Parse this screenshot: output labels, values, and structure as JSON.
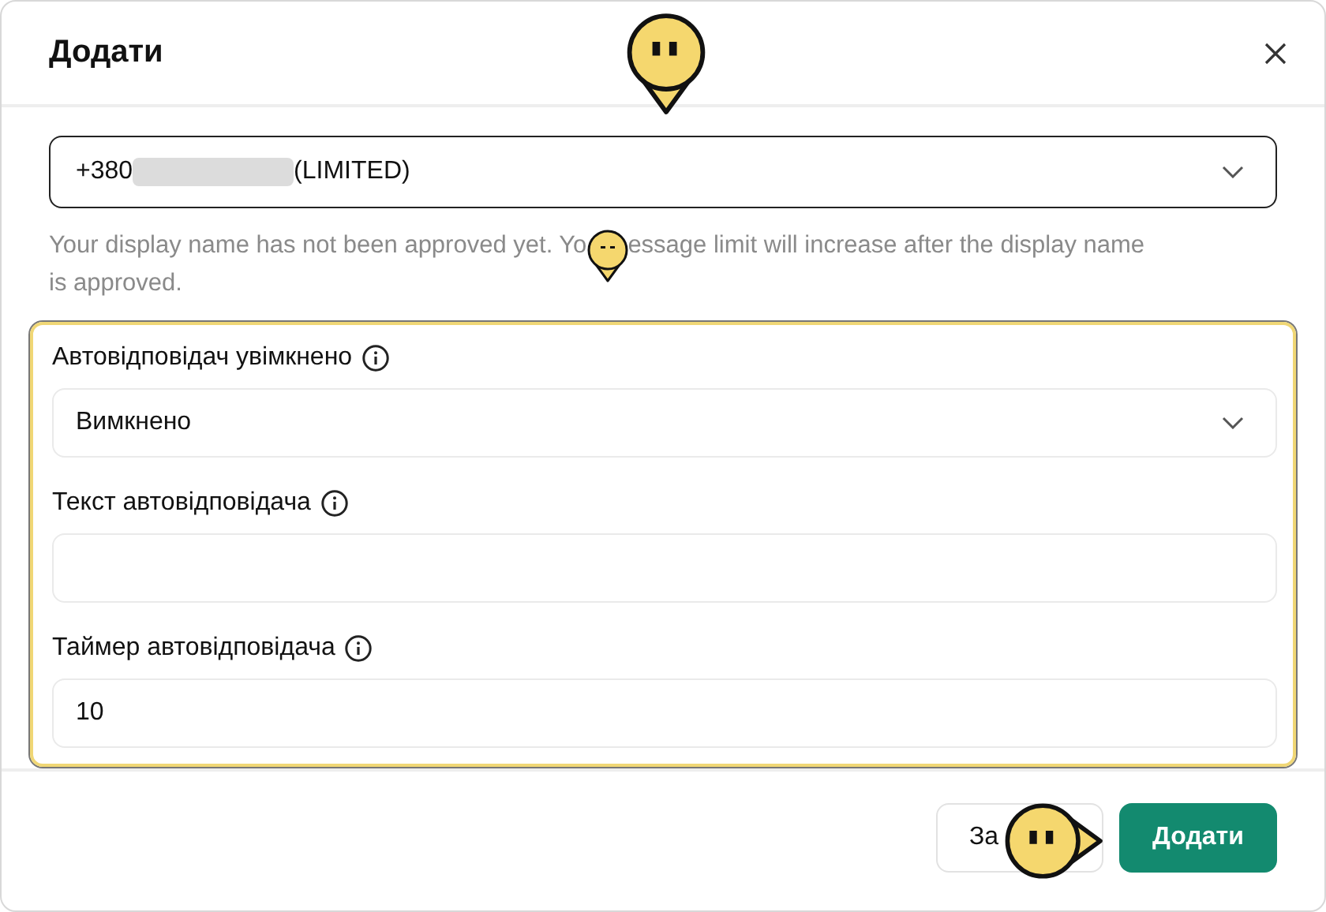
{
  "dialog": {
    "title": "Додати"
  },
  "account_select": {
    "prefix": "+380",
    "suffix": "(LIMITED)",
    "redacted": true
  },
  "help_text": {
    "before": "Your display name has not been approved yet. Yo",
    "after": "essage limit will increase after the display name",
    "continuation": "is approved."
  },
  "fields": [
    {
      "kind": "select",
      "label": "Автовідповідач увімкнено",
      "value": "Вимкнено"
    },
    {
      "kind": "text",
      "label": "Текст автовідповідача"
    },
    {
      "kind": "text",
      "label": "Таймер автовідповідача",
      "value": "10"
    }
  ],
  "buttons": [
    {
      "kind": "secondary",
      "label": "За"
    },
    {
      "kind": "primary",
      "label": "Додати"
    }
  ]
}
